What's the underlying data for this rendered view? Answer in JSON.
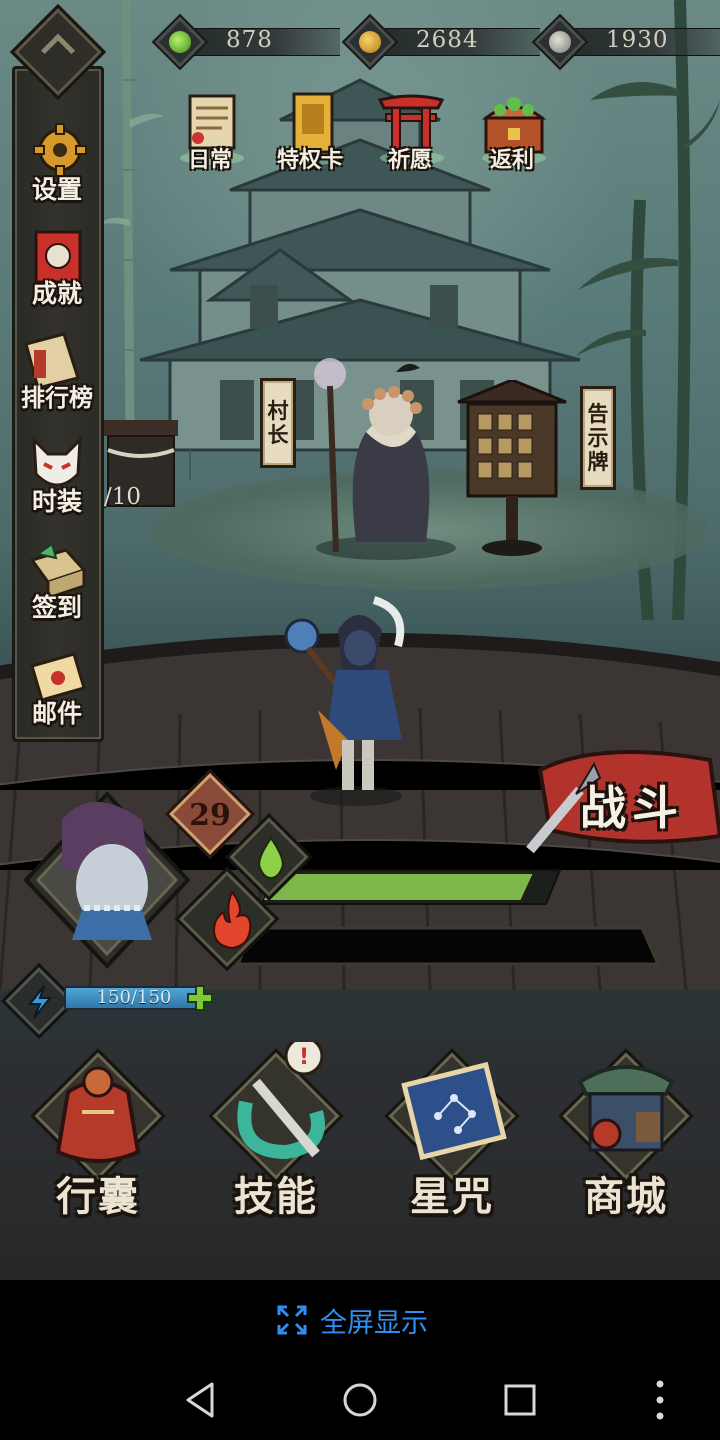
{
  "resources": [
    {
      "icon": "green-jade-icon",
      "value": "878"
    },
    {
      "icon": "gold-coin-icon",
      "value": "2684"
    },
    {
      "icon": "silver-coin-icon",
      "value": "1930"
    }
  ],
  "side_menu": [
    {
      "id": "settings",
      "icon": "gear-icon",
      "label": "设置"
    },
    {
      "id": "achievements",
      "icon": "achievement-scroll-icon",
      "label": "成就"
    },
    {
      "id": "leaderboard",
      "icon": "ranking-scroll-icon",
      "label": "排行榜"
    },
    {
      "id": "fashion",
      "icon": "fox-mask-icon",
      "label": "时装"
    },
    {
      "id": "checkin",
      "icon": "gift-box-icon",
      "label": "签到"
    },
    {
      "id": "mail",
      "icon": "envelope-icon",
      "label": "邮件"
    }
  ],
  "top_functions": [
    {
      "id": "daily",
      "icon": "daily-scroll-icon",
      "label": "日常"
    },
    {
      "id": "privilege",
      "icon": "privilege-card-icon",
      "label": "特权卡"
    },
    {
      "id": "pray",
      "icon": "torii-gate-icon",
      "label": "祈愿"
    },
    {
      "id": "rebate",
      "icon": "treasure-chest-icon",
      "label": "返利"
    }
  ],
  "npcs": {
    "village_chief_sign": [
      "村",
      "长"
    ],
    "notice_board_sign": [
      "告",
      "示",
      "牌"
    ]
  },
  "partial_counter": "/10",
  "battle_button": "战斗",
  "player": {
    "level": "29",
    "energy": "150/150",
    "energy_fraction": 1.0,
    "xp_fraction": 0.95,
    "hp_fraction": 0.0
  },
  "bottom_nav": [
    {
      "id": "bag",
      "icon": "pouch-icon",
      "label": "行囊"
    },
    {
      "id": "skills",
      "icon": "snake-blade-icon",
      "label": "技能",
      "badge": "!"
    },
    {
      "id": "stars",
      "icon": "star-chart-scroll-icon",
      "label": "星咒"
    },
    {
      "id": "shop",
      "icon": "shop-stall-icon",
      "label": "商城"
    }
  ],
  "fullscreen_label": "全屏显示",
  "colors": {
    "accent_blue": "#2f8ef0",
    "xp_green": "#7fb84a",
    "energy_blue": "#3a8fc4"
  }
}
